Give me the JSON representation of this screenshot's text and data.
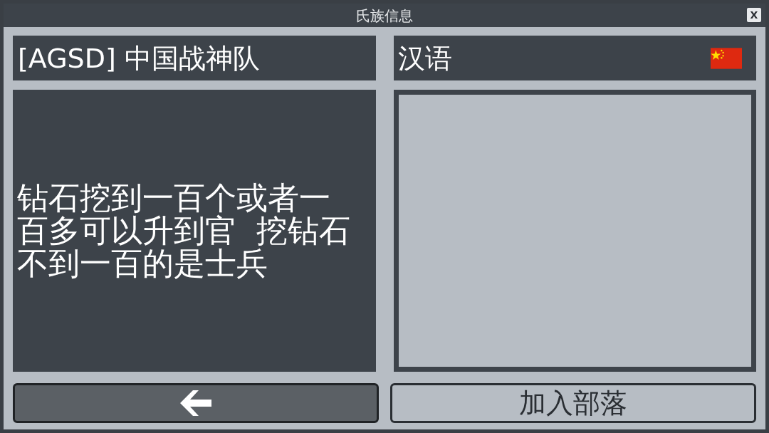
{
  "window": {
    "title": "氏族信息",
    "close_label": "X"
  },
  "clan": {
    "name": "[AGSD] 中国战神队",
    "language": "汉语",
    "description": "钻石挖到一百个或者一百多可以升到官  挖钻石不到一百的是士兵"
  },
  "buttons": {
    "join": "加入部落"
  }
}
